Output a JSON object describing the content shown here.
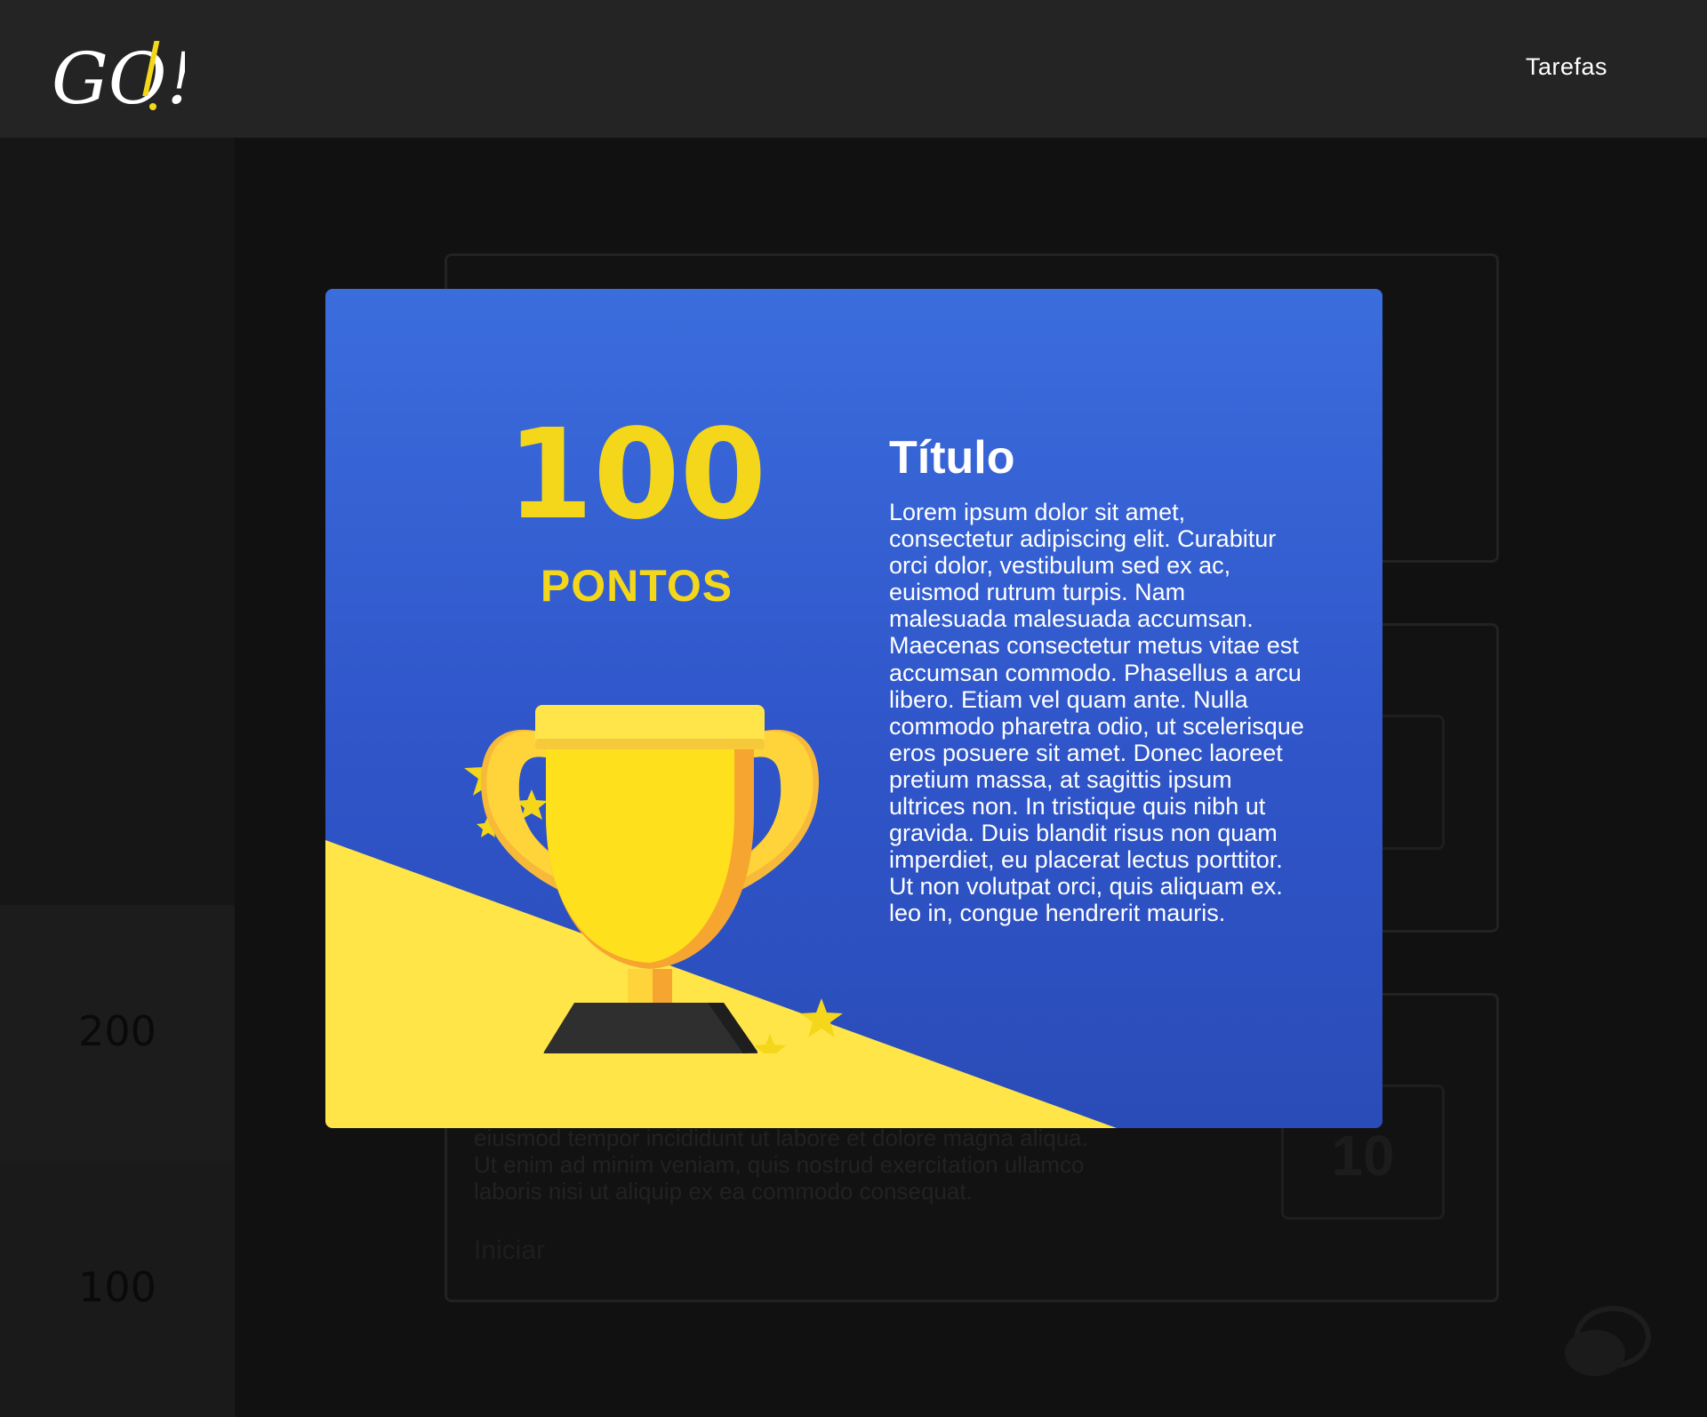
{
  "header": {
    "logo_text": "GO!",
    "nav": {
      "tarefas": "Tarefas"
    }
  },
  "background": {
    "sidebar": [
      {
        "points": "200"
      },
      {
        "points": "100"
      }
    ],
    "card": {
      "text_lines": [
        "eiusmod tempor incididunt ut labore et dolore magna aliqua.",
        "Ut enim ad minim veniam, quis nostrud exercitation ullamco",
        "laboris nisi ut aliquip ex ea commodo consequat."
      ],
      "action": "Iniciar",
      "day": "10"
    }
  },
  "modal": {
    "points_value": "100",
    "points_label": "PONTOS",
    "title": "Título",
    "body": "Lorem ipsum dolor sit amet, consectetur adipiscing elit. Curabitur orci dolor, vestibulum sed ex ac, euismod rutrum turpis. Nam malesuada malesuada accumsan. Maecenas consectetur metus vitae est accumsan commodo. Phasellus a arcu libero. Etiam vel quam ante. Nulla commodo pharetra odio, ut scelerisque eros posuere sit amet. Donec laoreet pretium massa, at sagittis ipsum ultrices non. In tristique quis nibh ut gravida. Duis blandit risus non quam imperdiet, eu placerat lectus porttitor. Ut non volutpat orci, quis aliquam ex. leo in, congue hendrerit mauris."
  },
  "colors": {
    "header_bg": "#242424",
    "modal_blue": "#3566d8",
    "modal_yellow": "#ffe548",
    "accent_yellow": "#f4d71a"
  }
}
